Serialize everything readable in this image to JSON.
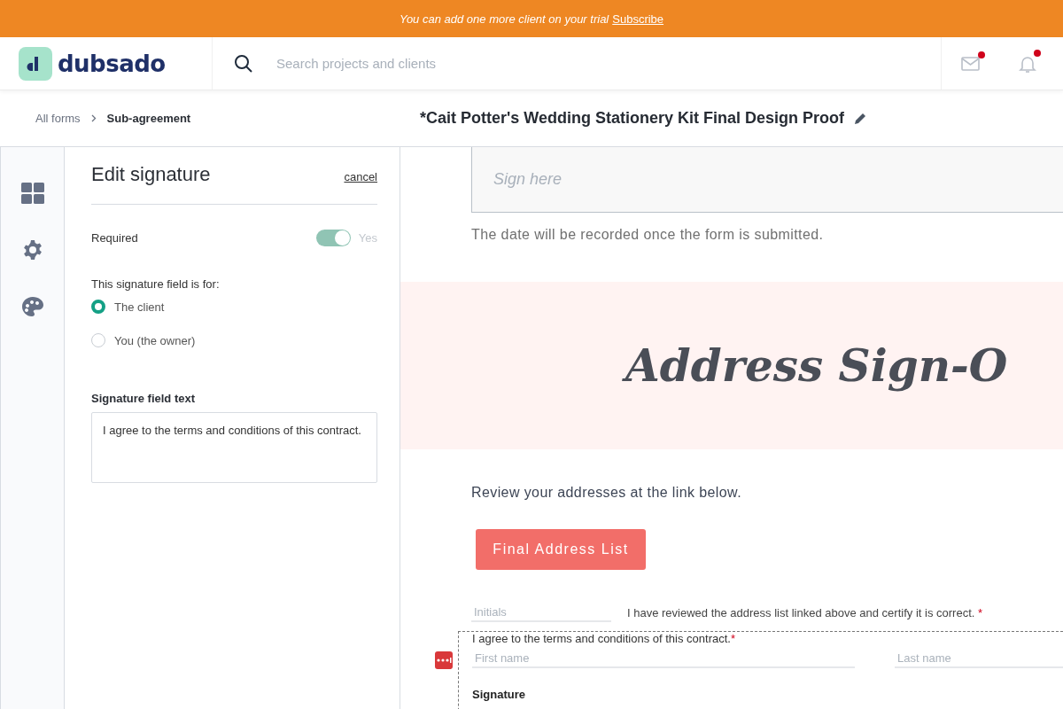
{
  "banner": {
    "text": "You can add one more client on your trial",
    "link": "Subscribe"
  },
  "header": {
    "logo_text": "dubsado",
    "search_placeholder": "Search projects and clients",
    "notifications": [
      {
        "kind": "mail",
        "unread": true
      },
      {
        "kind": "bell",
        "unread": true
      }
    ]
  },
  "breadcrumb": [
    {
      "label": "All forms",
      "current": false
    },
    {
      "label": "Sub-agreement",
      "current": true
    }
  ],
  "form_title": "*Cait Potter's Wedding Stationery Kit Final Design Proof",
  "panel": {
    "title": "Edit signature",
    "cancel": "cancel",
    "required": {
      "label": "Required",
      "on": true,
      "state_text": "Yes"
    },
    "signer": {
      "label": "This signature field is for:",
      "options": [
        {
          "label": "The client",
          "selected": true
        },
        {
          "label": "You (the owner)",
          "selected": false
        }
      ]
    },
    "field_text": {
      "label": "Signature field text",
      "value": "I agree to the terms and conditions of this contract."
    }
  },
  "canvas": {
    "sign_placeholder": "Sign here",
    "date_note": "The date will be recorded once the form is submitted.",
    "heading": "Address Sign-O",
    "review_text": "Review your addresses at the link below.",
    "button": "Final Address List",
    "initials": {
      "placeholder": "Initials",
      "statement": "I have reviewed the address list linked above and certify it is correct.",
      "mark": "*"
    },
    "agreement": {
      "text": "I agree to the terms and conditions of this contract.",
      "mark": "*",
      "first_name_placeholder": "First name",
      "last_name_placeholder": "Last name",
      "signature_label": "Signature"
    }
  }
}
